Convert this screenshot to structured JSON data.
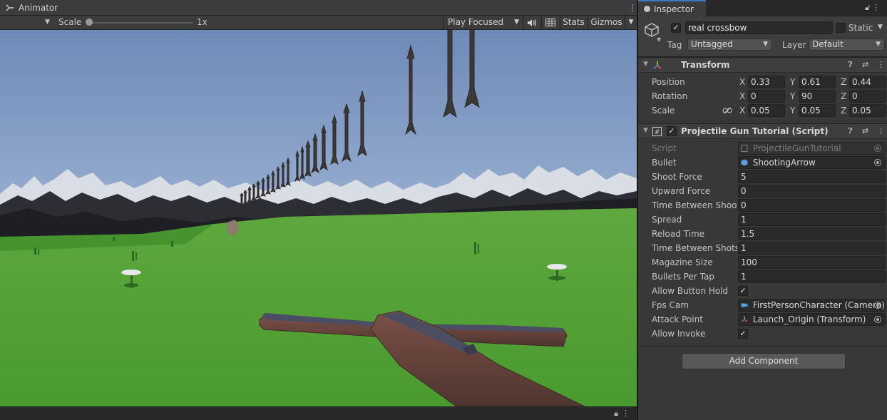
{
  "game_window": {
    "tab_label": "Animator",
    "scale_label": "Scale",
    "scale_value": "1x",
    "scale_fraction": 0.0,
    "play_mode": "Play Focused",
    "stats_label": "Stats",
    "gizmos_label": "Gizmos"
  },
  "inspector": {
    "tab_label": "Inspector",
    "game_object": {
      "active": true,
      "name": "real crossbow",
      "static_label": "Static",
      "is_static": false,
      "tag_label": "Tag",
      "tag_value": "Untagged",
      "layer_label": "Layer",
      "layer_value": "Default"
    },
    "transform": {
      "title": "Transform",
      "rows": [
        {
          "label": "Position",
          "x": "0.33",
          "y": "0.61",
          "z": "0.44"
        },
        {
          "label": "Rotation",
          "x": "0",
          "y": "90",
          "z": "0"
        },
        {
          "label": "Scale",
          "x": "0.05",
          "y": "0.05",
          "z": "0.05"
        }
      ],
      "axes": {
        "x": "X",
        "y": "Y",
        "z": "Z"
      }
    },
    "script_component": {
      "title": "Projectile Gun Tutorial (Script)",
      "enabled": true,
      "fields": [
        {
          "label": "Script",
          "value": "ProjectileGunTutorial"
        },
        {
          "label": "Bullet",
          "value": "ShootingArrow"
        },
        {
          "label": "Shoot Force",
          "value": "5"
        },
        {
          "label": "Upward Force",
          "value": "0"
        },
        {
          "label": "Time Between Shooti",
          "value": "0"
        },
        {
          "label": "Spread",
          "value": "1"
        },
        {
          "label": "Reload Time",
          "value": "1.5"
        },
        {
          "label": "Time Between Shots",
          "value": "1"
        },
        {
          "label": "Magazine Size",
          "value": "100"
        },
        {
          "label": "Bullets Per Tap",
          "value": "1"
        },
        {
          "label": "Allow Button Hold",
          "checked": true
        },
        {
          "label": "Fps Cam",
          "value": "FirstPersonCharacter (Camera)"
        },
        {
          "label": "Attack Point",
          "value": "Launch_Origin (Transform)"
        },
        {
          "label": "Allow Invoke",
          "checked": true
        }
      ]
    },
    "add_component_label": "Add Component"
  },
  "colors": {
    "sky_top": "#6f8ab8",
    "sky_bottom": "#b6cbe6",
    "grass": "#4f9f34",
    "accent": "#3a79bb"
  }
}
